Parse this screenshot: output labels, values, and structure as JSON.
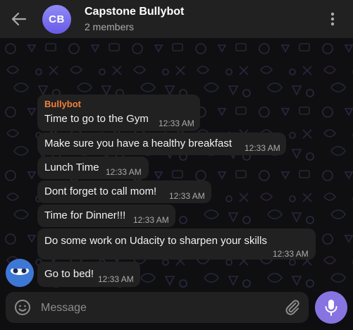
{
  "header": {
    "avatar_initials": "CB",
    "title": "Capstone Bullybot",
    "subtitle": "2 members",
    "back_icon": "arrow-left-icon",
    "more_icon": "more-vertical-icon"
  },
  "messages": [
    {
      "sender": "Bullybot",
      "text": "Time to go to the Gym",
      "time": "12:33 AM"
    },
    {
      "text": "Make sure you have a healthy breakfast",
      "time": "12:33 AM"
    },
    {
      "text": "Lunch Time",
      "time": "12:33 AM"
    },
    {
      "text": "Dont forget to call mom!",
      "time": "12:33 AM"
    },
    {
      "text": "Time for Dinner!!!",
      "time": "12:33 AM"
    },
    {
      "text": "Do some work on Udacity to sharpen your skills",
      "time": "12:33 AM"
    },
    {
      "text": "Go to bed!",
      "time": "12:33 AM"
    }
  ],
  "composer": {
    "placeholder": "Message",
    "emoji_icon": "smile-icon",
    "attach_icon": "paperclip-icon",
    "send_icon": "microphone-icon"
  },
  "colors": {
    "header_bg": "#212121",
    "bubble_bg": "#212121",
    "sender_name": "#f1803d",
    "accent": "#8774e1",
    "avatar_gradient_top": "#8f8bf7",
    "avatar_gradient_bottom": "#6a5ae8",
    "bot_avatar_bg": "#3e78d6"
  }
}
